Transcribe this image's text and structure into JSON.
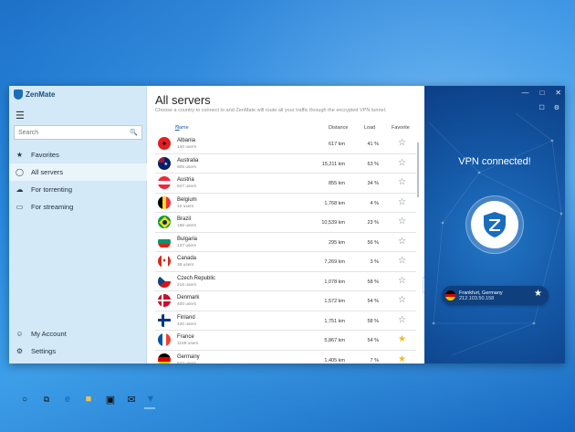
{
  "app": {
    "name": "ZenMate"
  },
  "sidebar": {
    "search_placeholder": "Search",
    "items": [
      {
        "label": "Favorites",
        "icon": "star-icon"
      },
      {
        "label": "All servers",
        "icon": "globe-icon"
      },
      {
        "label": "For torrenting",
        "icon": "cloud-download-icon"
      },
      {
        "label": "For streaming",
        "icon": "monitor-icon"
      }
    ],
    "bottom": [
      {
        "label": "My Account",
        "icon": "user-icon"
      },
      {
        "label": "Settings",
        "icon": "gear-icon"
      }
    ]
  },
  "main": {
    "title": "All servers",
    "subtitle": "Choose a country to connect to and ZenMate will route all your traffic through the encrypted VPN tunnel.",
    "columns": {
      "name": "Name",
      "distance": "Distance",
      "load": "Load",
      "favorite": "Favorite"
    },
    "servers": [
      {
        "country": "Albania",
        "users": "140 users",
        "distance": "617 km",
        "load": "41 %",
        "favorite": false,
        "flag": "al"
      },
      {
        "country": "Australia",
        "users": "805 users",
        "distance": "15,211 km",
        "load": "63 %",
        "favorite": false,
        "flag": "au"
      },
      {
        "country": "Austria",
        "users": "847 users",
        "distance": "855 km",
        "load": "34 %",
        "favorite": false,
        "flag": "at"
      },
      {
        "country": "Belgium",
        "users": "42 users",
        "distance": "1,768 km",
        "load": "4 %",
        "favorite": false,
        "flag": "be"
      },
      {
        "country": "Brazil",
        "users": "186 users",
        "distance": "10,539 km",
        "load": "23 %",
        "favorite": false,
        "flag": "br"
      },
      {
        "country": "Bulgaria",
        "users": "137 users",
        "distance": "295 km",
        "load": "56 %",
        "favorite": false,
        "flag": "bg"
      },
      {
        "country": "Canada",
        "users": "38 users",
        "distance": "7,269 km",
        "load": "3 %",
        "favorite": false,
        "flag": "ca"
      },
      {
        "country": "Czech Republic",
        "users": "216 users",
        "distance": "1,078 km",
        "load": "58 %",
        "favorite": false,
        "flag": "cz"
      },
      {
        "country": "Denmark",
        "users": "400 users",
        "distance": "1,572 km",
        "load": "54 %",
        "favorite": false,
        "flag": "dk"
      },
      {
        "country": "Finland",
        "users": "420 users",
        "distance": "1,751 km",
        "load": "58 %",
        "favorite": false,
        "flag": "fi"
      },
      {
        "country": "France",
        "users": "1168 users",
        "distance": "5,867 km",
        "load": "54 %",
        "favorite": true,
        "flag": "fr"
      },
      {
        "country": "Germany",
        "users": "622 users",
        "distance": "1,405 km",
        "load": "7 %",
        "favorite": true,
        "flag": "de"
      }
    ]
  },
  "vpn": {
    "status": "VPN connected!",
    "location": "Frankfurt, Germany",
    "ip": "212.103.50.158"
  },
  "colors": {
    "accent": "#1c76c7",
    "panel": "#155aa8",
    "favorite": "#f0b72b"
  }
}
